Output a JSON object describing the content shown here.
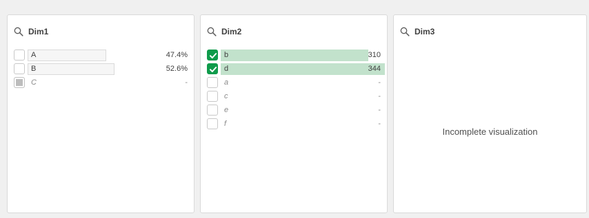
{
  "panels": {
    "dim1": {
      "title": "Dim1",
      "rows": [
        {
          "label": "A",
          "value": "47.4%",
          "state": "possible",
          "share": 0.474
        },
        {
          "label": "B",
          "value": "52.6%",
          "state": "possible",
          "share": 0.526
        },
        {
          "label": "C",
          "value": "-",
          "state": "excluded"
        }
      ]
    },
    "dim2": {
      "title": "Dim2",
      "rows": [
        {
          "label": "b",
          "value": "310",
          "state": "selected",
          "share": 0.901
        },
        {
          "label": "d",
          "value": "344",
          "state": "selected",
          "share": 1.0
        },
        {
          "label": "a",
          "value": "-",
          "state": "alternative"
        },
        {
          "label": "c",
          "value": "-",
          "state": "alternative"
        },
        {
          "label": "e",
          "value": "-",
          "state": "alternative"
        },
        {
          "label": "f",
          "value": "-",
          "state": "alternative"
        }
      ]
    },
    "dim3": {
      "title": "Dim3",
      "message": "Incomplete visualization"
    }
  },
  "colors": {
    "selected": "#0f9b4b",
    "selected_bar": "#c2e2cc",
    "background": "#f0f0f0"
  },
  "icons": {
    "search": "search-icon",
    "checkmark": "checkmark-icon"
  }
}
